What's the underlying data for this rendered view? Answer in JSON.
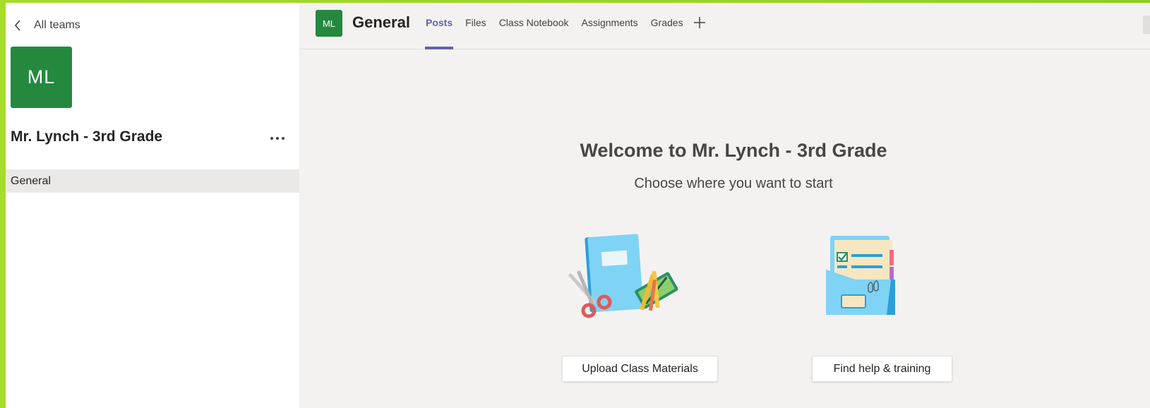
{
  "sidebar": {
    "back_label": "All teams",
    "team_initials": "ML",
    "team_name": "Mr. Lynch - 3rd Grade",
    "channels": [
      {
        "label": "General",
        "selected": true
      }
    ]
  },
  "header": {
    "channel_initials": "ML",
    "channel_title": "General",
    "tabs": [
      {
        "label": "Posts",
        "active": true
      },
      {
        "label": "Files",
        "active": false
      },
      {
        "label": "Class Notebook",
        "active": false
      },
      {
        "label": "Assignments",
        "active": false
      },
      {
        "label": "Grades",
        "active": false
      }
    ]
  },
  "main": {
    "welcome": "Welcome to Mr. Lynch - 3rd Grade",
    "subtitle": "Choose where you want to start",
    "actions": {
      "upload_label": "Upload Class Materials",
      "help_label": "Find help & training"
    }
  },
  "icons": {
    "back": "chevron-left-icon",
    "more": "more-options-icon",
    "add_tab": "plus-icon"
  },
  "colors": {
    "accent": "#6264a7",
    "team_green": "#24893f",
    "background": "#f3f2f1"
  }
}
